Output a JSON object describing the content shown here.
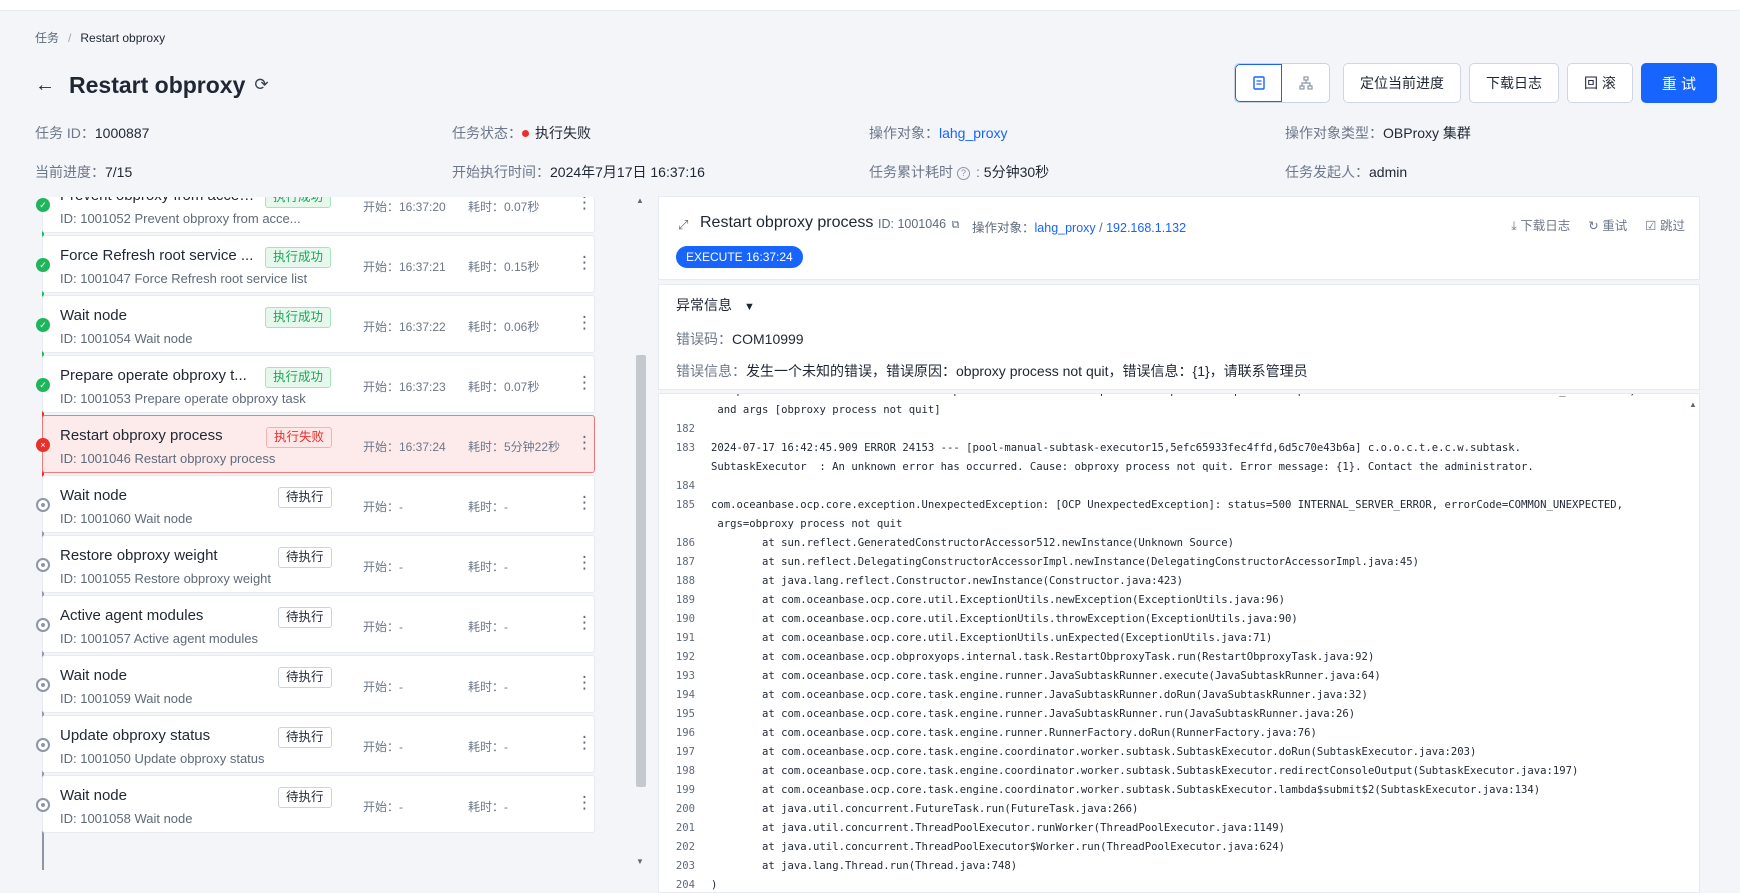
{
  "breadcrumb": {
    "root": "任务",
    "current": "Restart obproxy"
  },
  "header": {
    "title": "Restart obproxy"
  },
  "actions": {
    "locate": "定位当前进度",
    "download_log": "下载日志",
    "rollback": "回 滚",
    "retry": "重 试"
  },
  "meta": {
    "task_id_label": "任务 ID：",
    "task_id": "1000887",
    "status_label": "任务状态：",
    "status": "执行失败",
    "target_label": "操作对象：",
    "target": "lahg_proxy",
    "target_type_label": "操作对象类型：",
    "target_type": "OBProxy 集群",
    "progress_label": "当前进度：",
    "progress": "7/15",
    "start_label": "开始执行时间：",
    "start": "2024年7月17日 16:37:16",
    "elapsed_label": "任务累计耗时",
    "elapsed": "5分钟30秒",
    "initiator_label": "任务发起人：",
    "initiator": "admin"
  },
  "tasks": [
    {
      "name": "Prevent obproxy from accepting connections",
      "sub": "ID: 1001052  Prevent obproxy from acce...",
      "tag": "执行成功",
      "status": "ok",
      "start": "开始：16:37:20",
      "dur": "耗时：0.07秒"
    },
    {
      "name": "Force Refresh root service ...",
      "sub": "ID: 1001047  Force Refresh root service list",
      "tag": "执行成功",
      "status": "ok",
      "start": "开始：16:37:21",
      "dur": "耗时：0.15秒"
    },
    {
      "name": "Wait node",
      "sub": "ID: 1001054  Wait node",
      "tag": "执行成功",
      "status": "ok",
      "start": "开始：16:37:22",
      "dur": "耗时：0.06秒"
    },
    {
      "name": "Prepare operate obproxy t...",
      "sub": "ID: 1001053  Prepare operate obproxy task",
      "tag": "执行成功",
      "status": "ok",
      "start": "开始：16:37:23",
      "dur": "耗时：0.07秒"
    },
    {
      "name": "Restart obproxy process",
      "sub": "ID: 1001046  Restart obproxy process",
      "tag": "执行失败",
      "status": "fail",
      "start": "开始：16:37:24",
      "dur": "耗时：5分钟22秒"
    },
    {
      "name": "Wait node",
      "sub": "ID: 1001060  Wait node",
      "tag": "待执行",
      "status": "pending",
      "start": "开始：-",
      "dur": "耗时：-"
    },
    {
      "name": "Restore obproxy weight",
      "sub": "ID: 1001055  Restore obproxy weight",
      "tag": "待执行",
      "status": "pending",
      "start": "开始：-",
      "dur": "耗时：-"
    },
    {
      "name": "Active agent modules",
      "sub": "ID: 1001057  Active agent modules",
      "tag": "待执行",
      "status": "pending",
      "start": "开始：-",
      "dur": "耗时：-"
    },
    {
      "name": "Wait node",
      "sub": "ID: 1001059  Wait node",
      "tag": "待执行",
      "status": "pending",
      "start": "开始：-",
      "dur": "耗时：-"
    },
    {
      "name": "Update obproxy status",
      "sub": "ID: 1001050  Update obproxy status",
      "tag": "待执行",
      "status": "pending",
      "start": "开始：-",
      "dur": "耗时：-"
    },
    {
      "name": "Wait node",
      "sub": "ID: 1001058  Wait node",
      "tag": "待执行",
      "status": "pending",
      "start": "开始：-",
      "dur": "耗时：-"
    }
  ],
  "detail": {
    "title": "Restart obproxy process",
    "id": "ID: 1001046",
    "target_label": "操作对象：",
    "target_cluster": "lahg_proxy",
    "target_sep": " / ",
    "target_ip": "192.168.1.132",
    "download": "下载日志",
    "retry": "重试",
    "skip": "跳过",
    "badge": "EXECUTE 16:37:24"
  },
  "error": {
    "toggle": "异常信息",
    "code_label": "错误码：",
    "code": "COM10999",
    "msg_label": "错误信息：",
    "msg": "发生一个未知的错误，错误原因：obproxy process not quit，错误信息：{1}，请联系管理员"
  },
  "log": [
    {
      "n": "",
      "t": "ExceptionUtils          : Unknown exception: com.oceanbase.ocp.core.exception.UnexpectedException occurred with code errorCode=COMMON_UNEXPECTED,"
    },
    {
      "n": "",
      "t": " and args [obproxy process not quit]"
    },
    {
      "n": "182",
      "t": ""
    },
    {
      "n": "183",
      "t": "2024-07-17 16:42:45.909 ERROR 24153 --- [pool-manual-subtask-executor15,5efc65933fec4ffd,6d5c70e43b6a] c.o.o.c.t.e.c.w.subtask."
    },
    {
      "n": "",
      "t": "SubtaskExecutor  : An unknown error has occurred. Cause: obproxy process not quit. Error message: {1}. Contact the administrator."
    },
    {
      "n": "184",
      "t": ""
    },
    {
      "n": "185",
      "t": "com.oceanbase.ocp.core.exception.UnexpectedException: [OCP UnexpectedException]: status=500 INTERNAL_SERVER_ERROR, errorCode=COMMON_UNEXPECTED,"
    },
    {
      "n": "",
      "t": " args=obproxy process not quit"
    },
    {
      "n": "186",
      "t": "        at sun.reflect.GeneratedConstructorAccessor512.newInstance(Unknown Source)"
    },
    {
      "n": "187",
      "t": "        at sun.reflect.DelegatingConstructorAccessorImpl.newInstance(DelegatingConstructorAccessorImpl.java:45)"
    },
    {
      "n": "188",
      "t": "        at java.lang.reflect.Constructor.newInstance(Constructor.java:423)"
    },
    {
      "n": "189",
      "t": "        at com.oceanbase.ocp.core.util.ExceptionUtils.newException(ExceptionUtils.java:96)"
    },
    {
      "n": "190",
      "t": "        at com.oceanbase.ocp.core.util.ExceptionUtils.throwException(ExceptionUtils.java:90)"
    },
    {
      "n": "191",
      "t": "        at com.oceanbase.ocp.core.util.ExceptionUtils.unExpected(ExceptionUtils.java:71)"
    },
    {
      "n": "192",
      "t": "        at com.oceanbase.ocp.obproxyops.internal.task.RestartObproxyTask.run(RestartObproxyTask.java:92)"
    },
    {
      "n": "193",
      "t": "        at com.oceanbase.ocp.core.task.engine.runner.JavaSubtaskRunner.execute(JavaSubtaskRunner.java:64)"
    },
    {
      "n": "194",
      "t": "        at com.oceanbase.ocp.core.task.engine.runner.JavaSubtaskRunner.doRun(JavaSubtaskRunner.java:32)"
    },
    {
      "n": "195",
      "t": "        at com.oceanbase.ocp.core.task.engine.runner.JavaSubtaskRunner.run(JavaSubtaskRunner.java:26)"
    },
    {
      "n": "196",
      "t": "        at com.oceanbase.ocp.core.task.engine.runner.RunnerFactory.doRun(RunnerFactory.java:76)"
    },
    {
      "n": "197",
      "t": "        at com.oceanbase.ocp.core.task.engine.coordinator.worker.subtask.SubtaskExecutor.doRun(SubtaskExecutor.java:203)"
    },
    {
      "n": "198",
      "t": "        at com.oceanbase.ocp.core.task.engine.coordinator.worker.subtask.SubtaskExecutor.redirectConsoleOutput(SubtaskExecutor.java:197)"
    },
    {
      "n": "199",
      "t": "        at com.oceanbase.ocp.core.task.engine.coordinator.worker.subtask.SubtaskExecutor.lambda$submit$2(SubtaskExecutor.java:134)"
    },
    {
      "n": "200",
      "t": "        at java.util.concurrent.FutureTask.run(FutureTask.java:266)"
    },
    {
      "n": "201",
      "t": "        at java.util.concurrent.ThreadPoolExecutor.runWorker(ThreadPoolExecutor.java:1149)"
    },
    {
      "n": "202",
      "t": "        at java.util.concurrent.ThreadPoolExecutor$Worker.run(ThreadPoolExecutor.java:624)"
    },
    {
      "n": "203",
      "t": "        at java.lang.Thread.run(Thread.java:748)"
    },
    {
      "n": "204",
      "t": ")"
    }
  ],
  "colors": {
    "primary": "#1764ff",
    "success": "#1fb55b",
    "danger": "#e8312d"
  }
}
